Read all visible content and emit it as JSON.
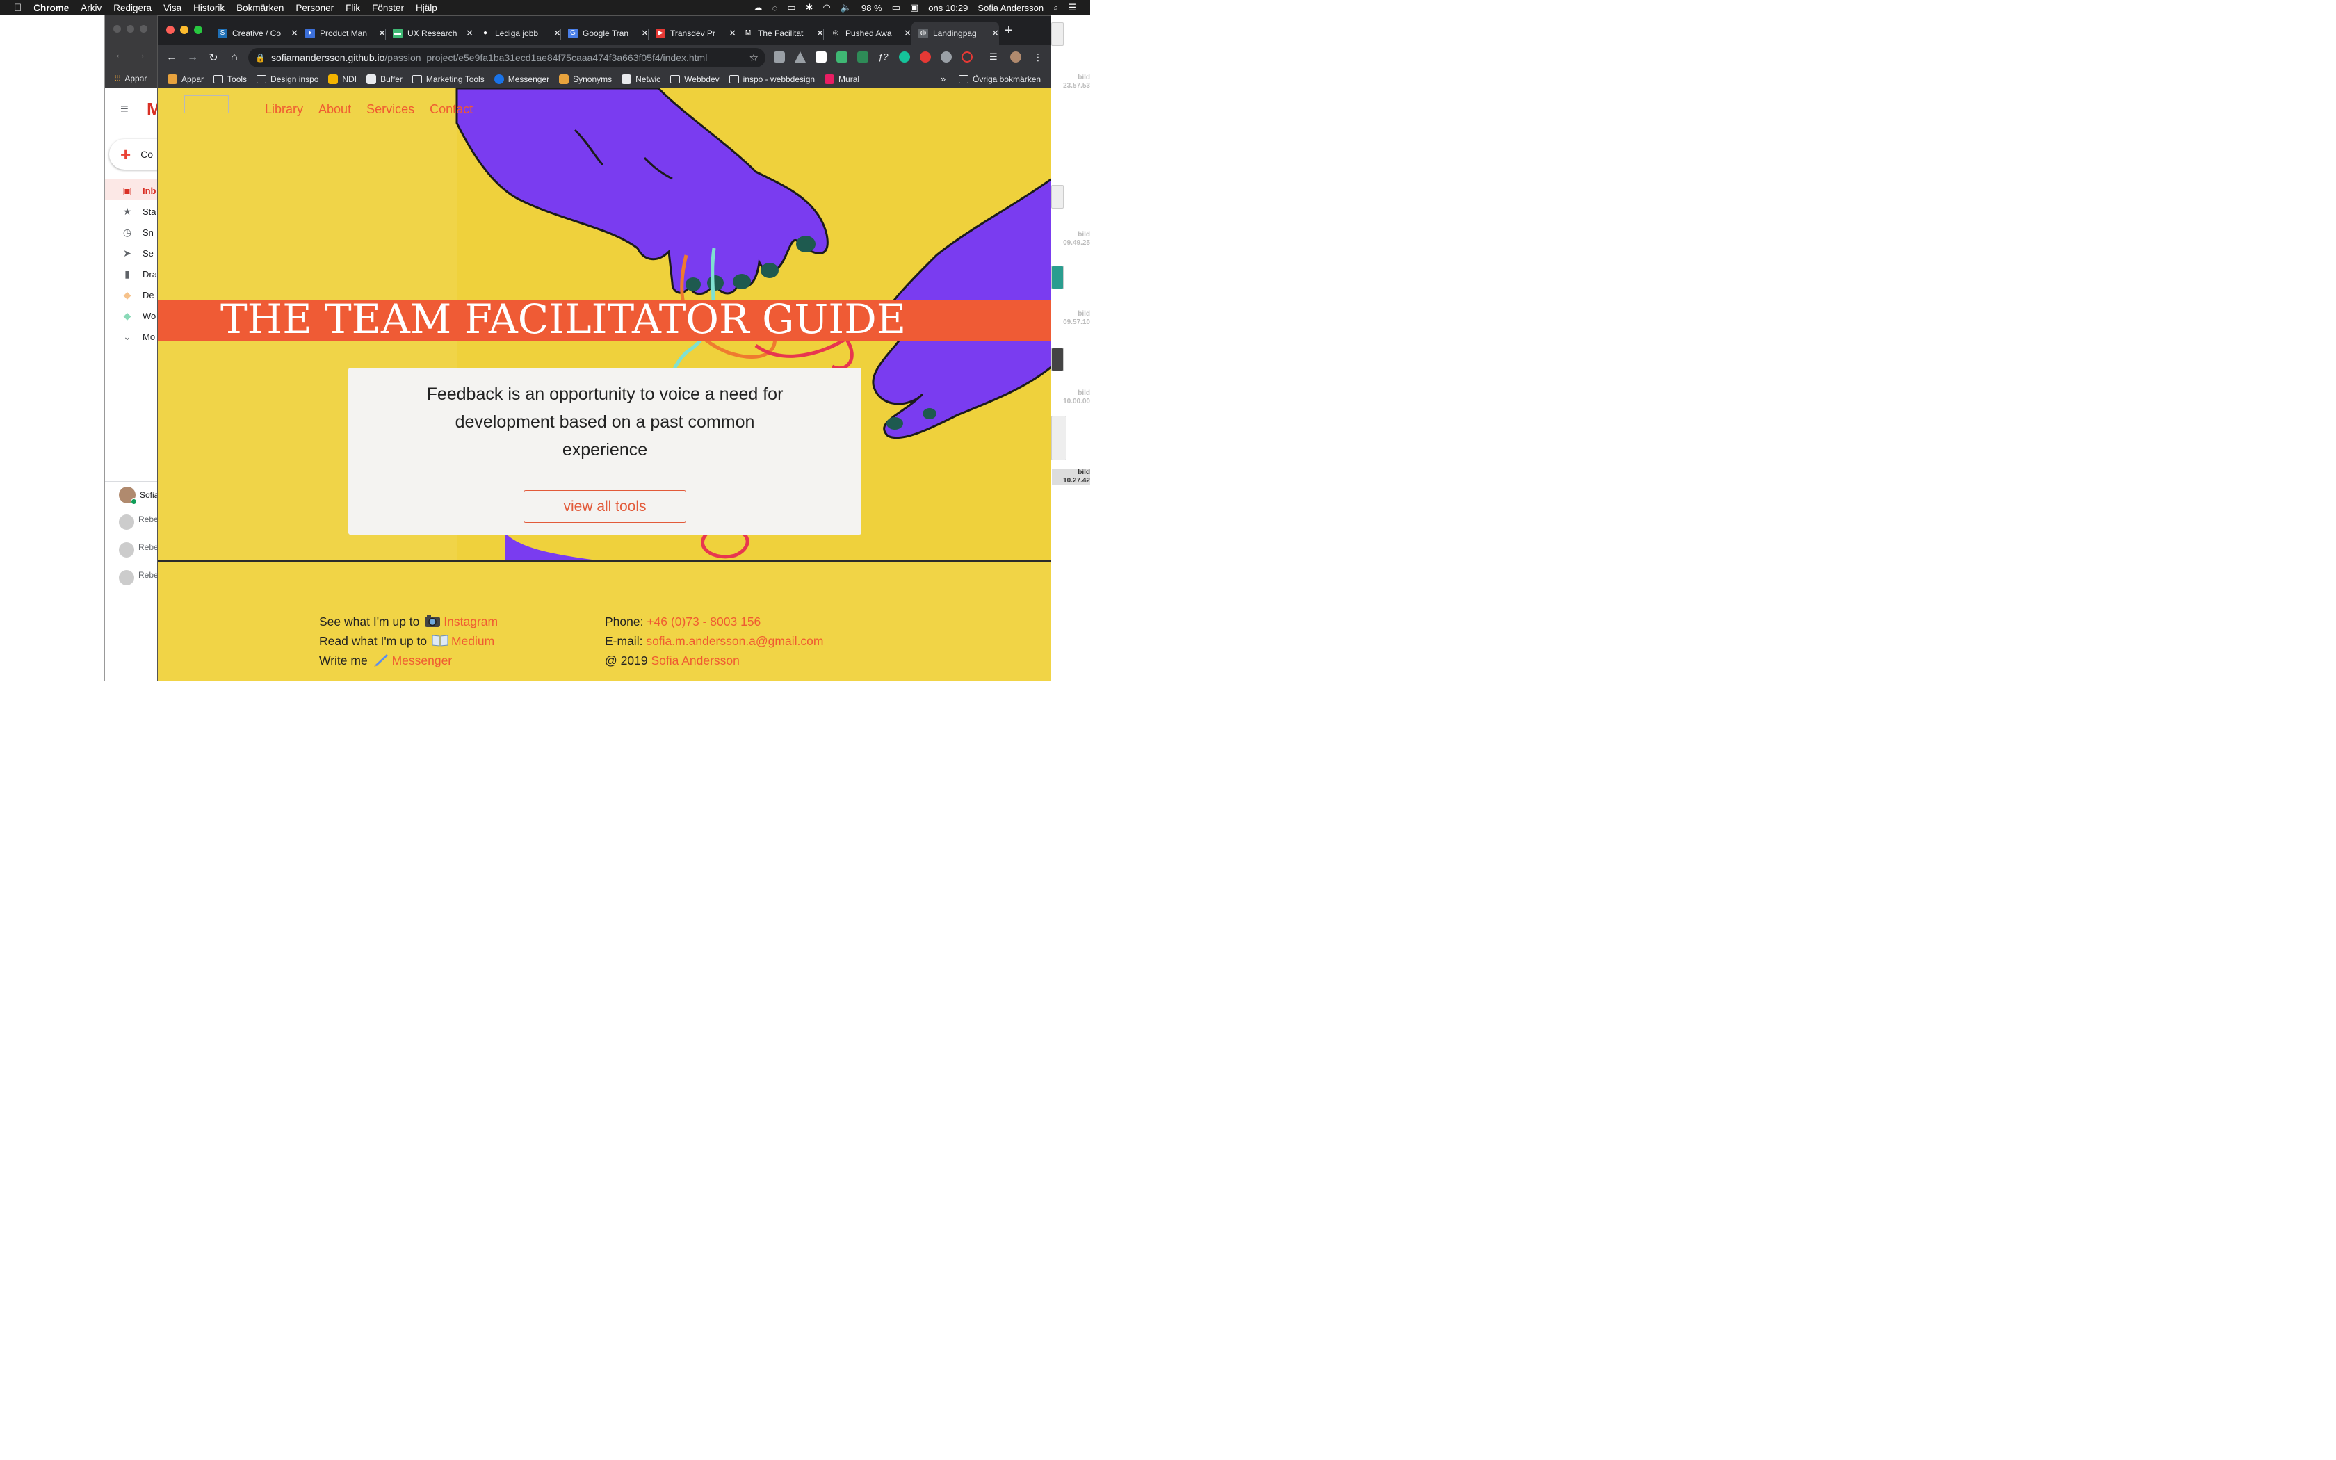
{
  "menubar": {
    "apple": "",
    "app": "Chrome",
    "items": [
      "Arkiv",
      "Redigera",
      "Visa",
      "Historik",
      "Bokmärken",
      "Personer",
      "Flik",
      "Fönster",
      "Hjälp"
    ],
    "battery": "98 %",
    "clock": "ons 10:29",
    "user": "Sofia Andersson"
  },
  "desktop": {
    "labels": [
      "bild\n23.57.53",
      "bild\n09.49.25",
      "bild\n09.57.10",
      "bild\n10.00.00",
      "bild\n10.27.42"
    ]
  },
  "bg_window": {
    "compose": "Co",
    "items": [
      {
        "icon": "inbox-icon",
        "label": "Inb",
        "active": true
      },
      {
        "icon": "star-icon",
        "label": "Sta"
      },
      {
        "icon": "clock-icon",
        "label": "Sn"
      },
      {
        "icon": "send-icon",
        "label": "Se"
      },
      {
        "icon": "draft-icon",
        "label": "Dra"
      },
      {
        "icon": "label-icon",
        "label": "De"
      },
      {
        "icon": "label-icon",
        "label": "Wo"
      },
      {
        "icon": "chevron-down-icon",
        "label": "Mo"
      }
    ],
    "account": "Sofia",
    "contacts": [
      "Rebe",
      "Rebe",
      "Rebe"
    ],
    "bookmark": "Appar"
  },
  "tabs": [
    {
      "title": "Creative / Co",
      "color": "#1f6fb5",
      "glyph": "S"
    },
    {
      "title": "Product Man",
      "color": "#3c6fd8",
      "glyph": "◗"
    },
    {
      "title": "UX Research",
      "color": "#3fb874",
      "glyph": "▬"
    },
    {
      "title": "Lediga jobb",
      "color": "#202124",
      "glyph": "●"
    },
    {
      "title": "Google Tran",
      "color": "#4a7fe8",
      "glyph": "G"
    },
    {
      "title": "Transdev Pr",
      "color": "#e53935",
      "glyph": "▶"
    },
    {
      "title": "The Facilitat",
      "color": "#202124",
      "glyph": "M"
    },
    {
      "title": "Pushed Awa",
      "color": "#202124",
      "glyph": "◎"
    },
    {
      "title": "Landingpag",
      "color": "#5f6368",
      "glyph": "◍",
      "active": true
    }
  ],
  "address": {
    "host": "sofiamandersson.github.io",
    "path": "/passion_project/e5e9fa1ba31ecd1ae84f75caaa474f3a663f05f4/index.html"
  },
  "bookmarks": [
    {
      "label": "Appar",
      "type": "apps"
    },
    {
      "label": "Tools",
      "type": "folder"
    },
    {
      "label": "Design inspo",
      "type": "folder"
    },
    {
      "label": "NDI",
      "type": "drive"
    },
    {
      "label": "Buffer",
      "type": "buffer"
    },
    {
      "label": "Marketing Tools",
      "type": "folder"
    },
    {
      "label": "Messenger",
      "type": "messenger"
    },
    {
      "label": "Synonyms",
      "type": "syn"
    },
    {
      "label": "Netwic",
      "type": "netwic"
    },
    {
      "label": "Webbdev",
      "type": "folder"
    },
    {
      "label": "inspo - webbdesign",
      "type": "folder"
    },
    {
      "label": "Mural",
      "type": "mural"
    }
  ],
  "bookmarks_overflow": "»",
  "other_bookmarks": "Övriga bokmärken",
  "site": {
    "nav": [
      "Library",
      "About",
      "Services",
      "Contact"
    ],
    "title": "THE TEAM FACILITATOR GUIDE",
    "quote": "Feedback is an opportunity to voice a need for development based on a past common experience",
    "cta": "view all tools",
    "footer": {
      "insta_prefix": "See what I'm up to",
      "insta_link": "Instagram",
      "medium_prefix": "Read what I'm up to",
      "medium_link": "Medium",
      "messenger_prefix": "Write me",
      "messenger_link": "Messenger",
      "phone_prefix": "Phone:",
      "phone": "+46 (0)73 - 8003 156",
      "email_prefix": "E-mail:",
      "email": "sofia.m.andersson.a@gmail.com",
      "copyright_prefix": "@ 2019",
      "copyright_name": "Sofia Andersson"
    }
  },
  "colors": {
    "page_yellow": "#efd33f",
    "accent_orange": "#ef5b35",
    "hand_purple": "#7a3cf0"
  }
}
